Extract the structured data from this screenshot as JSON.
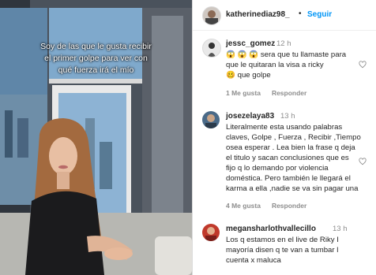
{
  "video": {
    "caption_lines": [
      "Soy de las que le gusta recibir",
      "el primer golpe para ver con",
      "qué fuerza irá el mío"
    ]
  },
  "header": {
    "username": "katherinediaz98_",
    "separator": "•",
    "follow_label": "Seguir"
  },
  "comments": [
    {
      "username": "jessc_gomez",
      "time": "12 h",
      "text_line1_tail": "sera que tu llamaste para",
      "text_line2": "que le quitaran la visa a ricky",
      "text_line3_tail": "que golpe",
      "likes": "1 Me gusta",
      "reply": "Responder"
    },
    {
      "username": "josezelaya83",
      "time": "13 h",
      "text_lines": [
        "Literalmente esta usando palabras",
        "claves, Golpe , Fuerza , Recibir ,Tiempo",
        "osea esperar . Lea bien la frase q deja",
        "el titulo y sacan conclusiones que es",
        "fijo q lo demando por violencia",
        "doméstica. Pero también le llegará el",
        "karma a ella ,nadie se va sin pagar una"
      ],
      "likes": "4 Me gusta",
      "reply": "Responder"
    },
    {
      "username": "megansharlothvallecillo",
      "time": "13 h",
      "text_lines": [
        "Los q estamos en el live de Riky I",
        "mayoría disen q te van a tumbar l",
        "cuenta x maluca"
      ]
    }
  ],
  "colors": {
    "link_blue": "#0095f6",
    "text": "#262626",
    "muted": "#8e8e8e",
    "emoji_red": "#e8352e",
    "emoji_yellow": "#f5b52a"
  }
}
